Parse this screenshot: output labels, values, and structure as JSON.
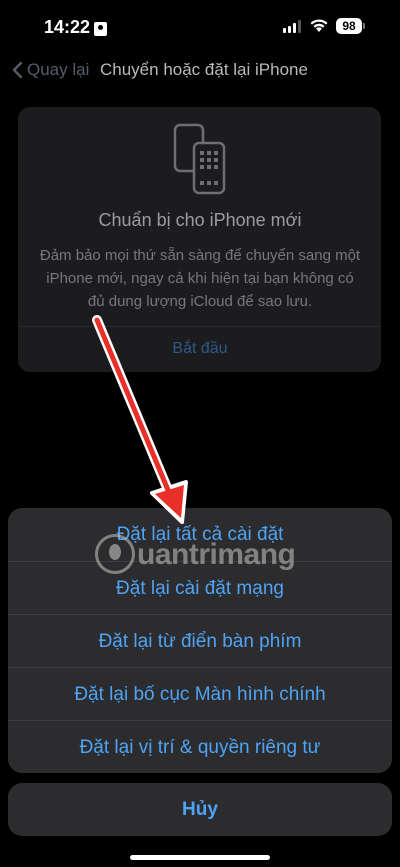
{
  "status": {
    "time": "14:22",
    "battery": "98"
  },
  "nav": {
    "back_label": "Quay lại",
    "title": "Chuyển hoặc đặt lại iPhone"
  },
  "prepare_card": {
    "title": "Chuẩn bị cho iPhone mới",
    "description": "Đảm bảo mọi thứ sẵn sàng để chuyển sang một iPhone mới, ngay cả khi hiện tại bạn không có đủ dung lượng iCloud để sao lưu.",
    "action": "Bắt đầu"
  },
  "action_sheet": {
    "items": [
      {
        "label": "Đặt lại tất cả cài đặt"
      },
      {
        "label": "Đặt lại cài đặt mạng"
      },
      {
        "label": "Đặt lại từ điển bàn phím"
      },
      {
        "label": "Đặt lại bố cục Màn hình chính"
      },
      {
        "label": "Đặt lại vị trí & quyền riêng tư"
      }
    ],
    "cancel": "Hủy"
  },
  "watermark": "uantrimang",
  "colors": {
    "accent": "#4ea3f5",
    "sheet_bg": "#2c2c2e",
    "arrow": "#e8302a"
  }
}
